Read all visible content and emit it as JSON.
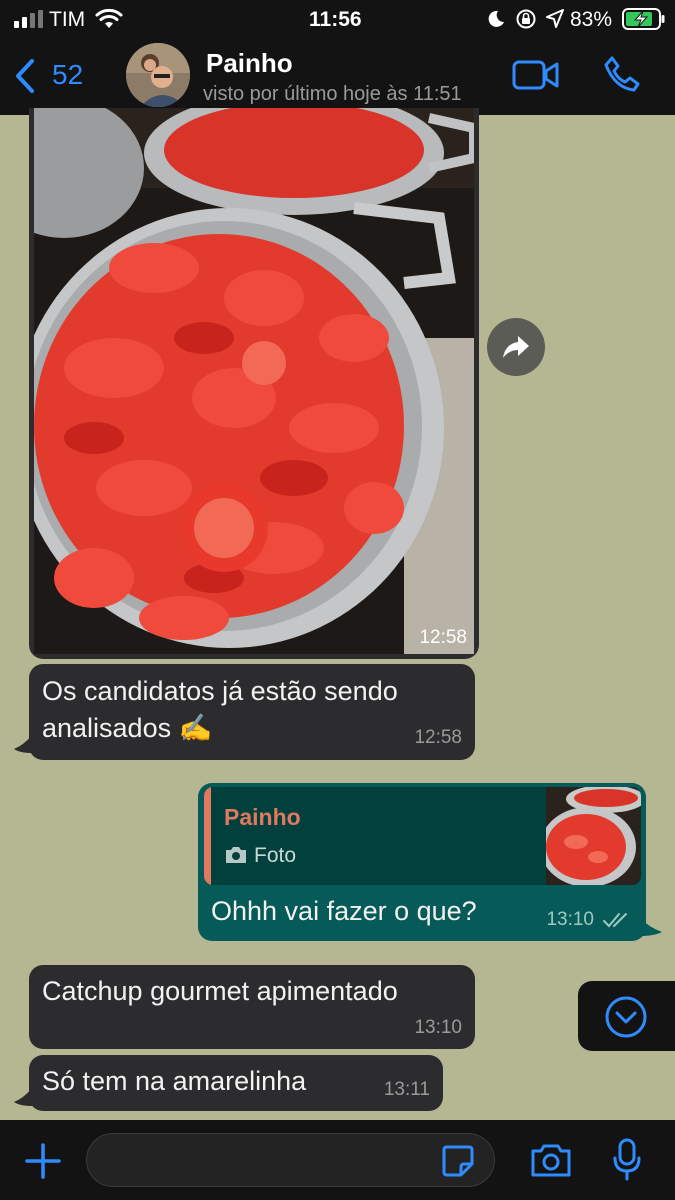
{
  "status": {
    "carrier": "TIM",
    "time": "11:56",
    "battery": "83%",
    "icons": [
      "signal-icon",
      "wifi-icon",
      "moon-icon",
      "orientation-lock-icon",
      "location-icon",
      "battery-icon"
    ]
  },
  "header": {
    "back_count": "52",
    "contact_name": "Painho",
    "last_seen": "visto por último hoje às 11:51",
    "icons": [
      "back-chevron-icon",
      "video-call-icon",
      "phone-icon"
    ]
  },
  "messages": [
    {
      "type": "image",
      "direction": "in",
      "time": "12:58"
    },
    {
      "type": "text",
      "direction": "in",
      "text": "Os candidatos já estão sendo analisados ✍️",
      "line1": "Os candidatos já estão sendo",
      "line2": "analisados ✍",
      "time": "12:58"
    },
    {
      "type": "reply",
      "direction": "out",
      "quoted_name": "Painho",
      "quoted_label": "Foto",
      "text": "Ohhh vai fazer o que?",
      "time": "13:10",
      "status": "read"
    },
    {
      "type": "text",
      "direction": "in",
      "text": "Catchup gourmet apimentado",
      "time": "13:10"
    },
    {
      "type": "text",
      "direction": "in",
      "text": "Só tem na amarelinha",
      "time": "13:11"
    }
  ],
  "colors": {
    "chat_background": "#b5b793",
    "incoming_bubble": "#2c2c2e",
    "outgoing_bubble": "#065a57",
    "accent_blue": "#2f8cff",
    "quote_name": "#e07a5f"
  },
  "input": {
    "placeholder": ""
  }
}
